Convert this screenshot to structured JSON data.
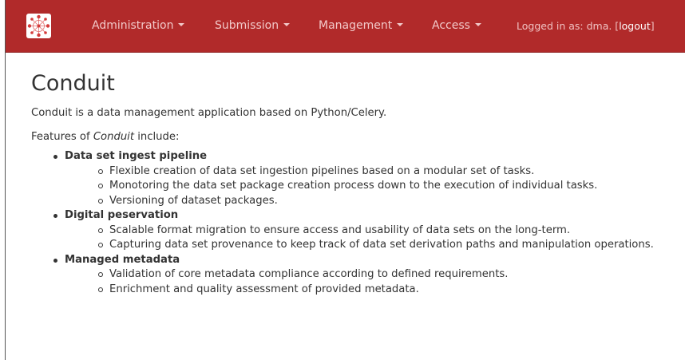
{
  "nav": {
    "items": [
      {
        "label": "Administration"
      },
      {
        "label": "Submission"
      },
      {
        "label": "Management"
      },
      {
        "label": "Access"
      }
    ],
    "login_prefix": "Logged in as: dma. [",
    "logout_label": "logout",
    "login_suffix": "]"
  },
  "page": {
    "title": "Conduit",
    "description": "Conduit is a data management application based on Python/Celery.",
    "features_prefix": "Features of ",
    "features_name": "Conduit",
    "features_suffix": " include:"
  },
  "features": [
    {
      "heading": "Data set ingest pipeline",
      "items": [
        "Flexible creation of data set ingestion pipelines based on a modular set of tasks.",
        "Monotoring the data set package creation process down to the execution of individual tasks.",
        "Versioning of dataset packages."
      ]
    },
    {
      "heading": "Digital peservation",
      "items": [
        "Scalable format migration to ensure access and usability of data sets on the long-term.",
        "Capturing data set provenance to keep track of data set derivation paths and manipulation operations."
      ]
    },
    {
      "heading": "Managed metadata",
      "items": [
        "Validation of core metadata compliance according to defined requirements.",
        "Enrichment and quality assessment of provided metadata."
      ]
    }
  ],
  "colors": {
    "navbar": "#b12a2a",
    "nav_text": "#f2c9c9",
    "body_text": "#333333"
  }
}
